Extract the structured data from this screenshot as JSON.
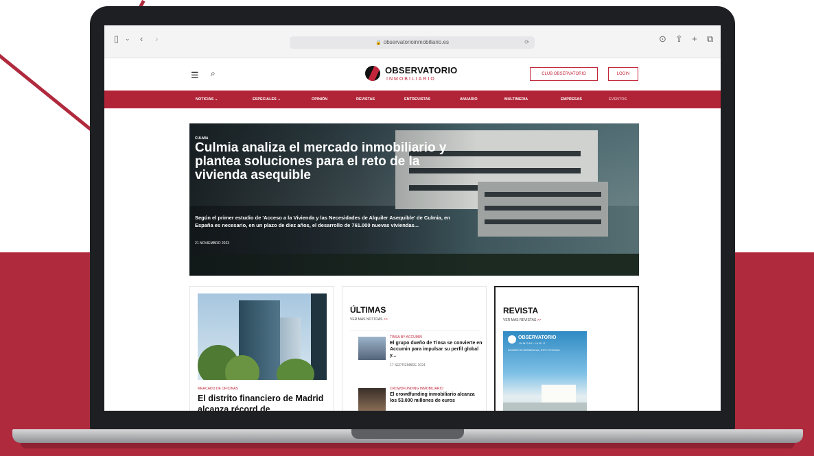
{
  "browser": {
    "url": "observatorioinmobiliario.es",
    "icons": {
      "sidebar": "sidebar-icon",
      "back": "chevron-left-icon",
      "forward": "chevron-right-icon",
      "lock": "lock-icon",
      "reload": "reload-icon",
      "download": "download-icon",
      "share": "share-icon",
      "new_tab": "plus-icon",
      "tabs": "tabs-icon"
    }
  },
  "site": {
    "logo_main": "OBSERVATORIO",
    "logo_sub": "INMOBILIARIO",
    "club_button": "CLUB OBSERVATORIO",
    "login_button": "LOGIN",
    "accent_color": "#b12437"
  },
  "nav": {
    "items": [
      {
        "label": "NOTICIAS"
      },
      {
        "label": "ESPECIALES"
      },
      {
        "label": "OPINIÓN"
      },
      {
        "label": "REVISTAS"
      },
      {
        "label": "ENTREVISTAS"
      },
      {
        "label": "ANUARIO"
      },
      {
        "label": "MULTIMEDIA"
      },
      {
        "label": "EMPRESAS"
      },
      {
        "label": "EVENTOS"
      }
    ]
  },
  "hero": {
    "category": "CULMIA",
    "title": "Culmia analiza el mercado inmobiliario y plantea soluciones para el reto de la vivienda asequible",
    "summary": "Según el primer estudio de 'Acceso a la Vivienda y las Necesidades de Alquiler Asequible' de Culmia, en España es necesario, en un plazo de diez años, el desarrollo de 761.000 nuevas viviendas...",
    "date": "21 NOVIEMBRO 2023"
  },
  "feature": {
    "category": "MERCADO DE OFICINAS",
    "title": "El distrito financiero de Madrid alcanza récord de"
  },
  "latest": {
    "heading": "ÚLTIMAS",
    "more": "VER MÁS NOTICIAS",
    "items": [
      {
        "category": "TINSA BY ACCUMIN",
        "title": "El grupo dueño de Tinsa se convierte en Accumin para impulsar su perfil global y...",
        "date": "17 SEPTIEMBRE 2024"
      },
      {
        "category": "CROWDFUNDING INMOBILIARIO",
        "title": "El crowdfunding inmobiliario alcanza los 53.000 millones de euros",
        "date": ""
      }
    ]
  },
  "magazine": {
    "heading": "REVISTA",
    "more": "VER MÁS REVISTAS",
    "cover_title": "OBSERVATORIO",
    "cover_sub": "INMOBILIARIO",
    "cover_desc": "DOSSIER DE RESIDENCIAL, BTR Y OFICINAS"
  }
}
